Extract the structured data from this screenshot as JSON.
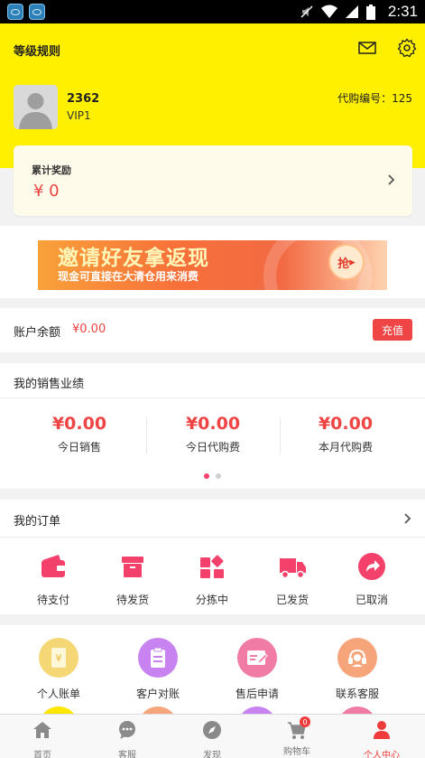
{
  "status_bar": {
    "time": "2:31"
  },
  "header": {
    "level_rule": "等级规则",
    "user_id": "2362",
    "vip_level": "VIP1",
    "agent_code": "代购编号：125"
  },
  "reward": {
    "title": "累计奖励",
    "value": "¥ 0"
  },
  "banner": {
    "title": "邀请好友拿返现",
    "subtitle": "现金可直接在大清仓用来消费",
    "button": "抢"
  },
  "balance": {
    "label": "账户余额",
    "value": "¥0.00",
    "recharge": "充值"
  },
  "sales": {
    "title": "我的销售业绩",
    "stats": [
      {
        "value": "¥0.00",
        "label": "今日销售"
      },
      {
        "value": "¥0.00",
        "label": "今日代购费"
      },
      {
        "value": "¥0.00",
        "label": "本月代购费"
      }
    ]
  },
  "orders": {
    "title": "我的订单",
    "items": [
      {
        "label": "待支付",
        "icon": "wallet-icon"
      },
      {
        "label": "待发货",
        "icon": "box-icon"
      },
      {
        "label": "分拣中",
        "icon": "grid-icon"
      },
      {
        "label": "已发货",
        "icon": "truck-icon"
      },
      {
        "label": "已取消",
        "icon": "cancel-arrow-icon"
      }
    ]
  },
  "services": [
    {
      "label": "个人账单",
      "icon": "bill-icon",
      "color": "#f5d776"
    },
    {
      "label": "客户对账",
      "icon": "clipboard-icon",
      "color": "#c883f0"
    },
    {
      "label": "售后申请",
      "icon": "edit-card-icon",
      "color": "#f07ba4"
    },
    {
      "label": "联系客服",
      "icon": "headset-icon",
      "color": "#f6a57a"
    }
  ],
  "tabbar": [
    {
      "label": "首页",
      "icon": "home-icon"
    },
    {
      "label": "客服",
      "icon": "chat-icon"
    },
    {
      "label": "发现",
      "icon": "compass-icon"
    },
    {
      "label": "购物车",
      "icon": "cart-icon",
      "badge": "0"
    },
    {
      "label": "个人中心",
      "icon": "person-icon"
    }
  ],
  "colors": {
    "header": "#fff000",
    "accent": "#ee4444",
    "order_icon": "#f4416c"
  }
}
